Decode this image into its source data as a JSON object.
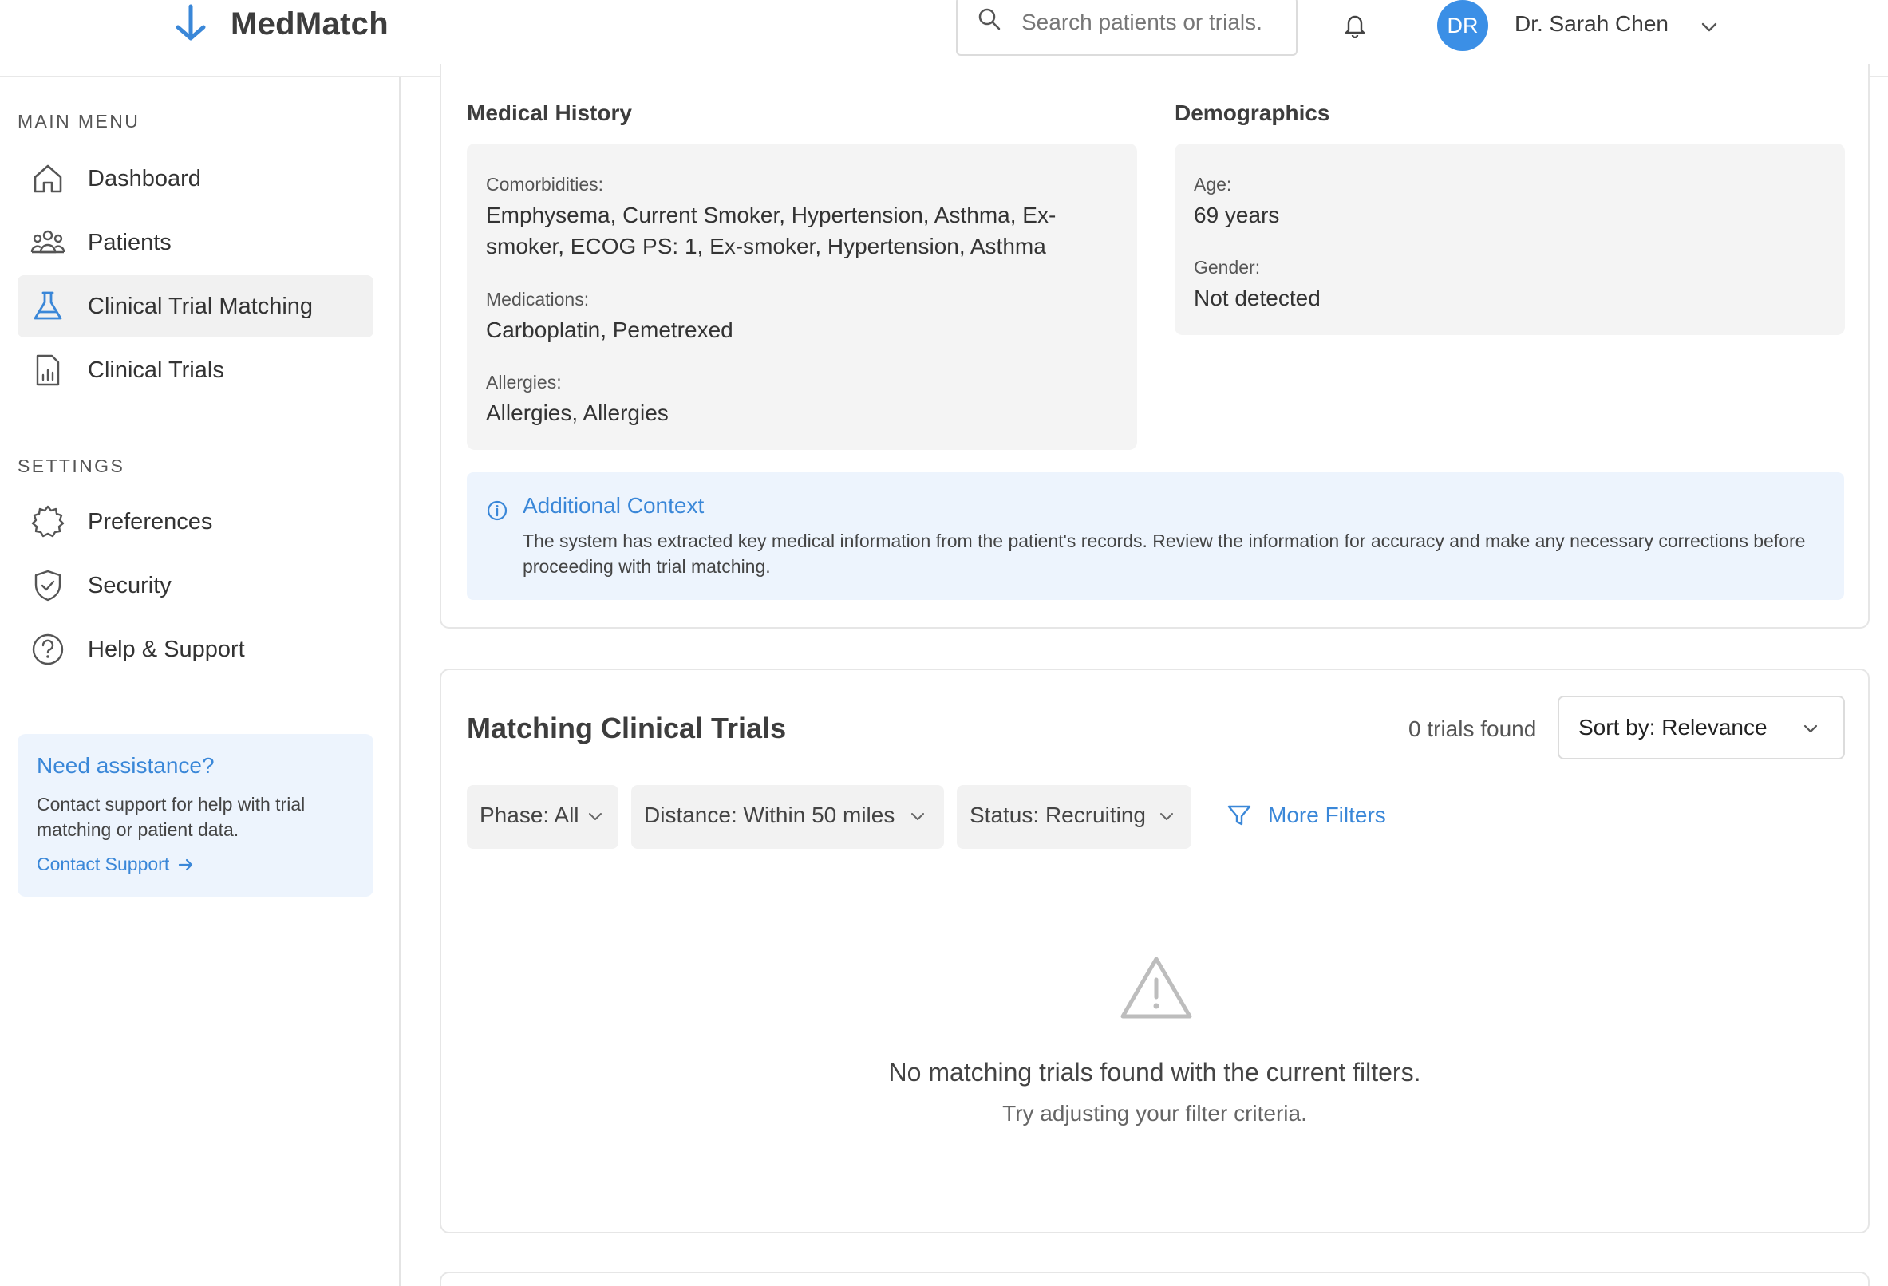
{
  "app": {
    "name": "MedMatch"
  },
  "header": {
    "search_placeholder": "Search patients or trials.",
    "user": {
      "initials": "DR",
      "name": "Dr. Sarah Chen"
    }
  },
  "sidebar": {
    "main_menu_label": "MAIN MENU",
    "main_items": [
      {
        "label": "Dashboard",
        "icon": "home-icon"
      },
      {
        "label": "Patients",
        "icon": "users-icon"
      },
      {
        "label": "Clinical Trial Matching",
        "icon": "flask-icon",
        "active": true
      },
      {
        "label": "Clinical Trials",
        "icon": "report-icon"
      }
    ],
    "settings_label": "SETTINGS",
    "settings_items": [
      {
        "label": "Preferences",
        "icon": "gear-icon"
      },
      {
        "label": "Security",
        "icon": "shield-icon"
      },
      {
        "label": "Help & Support",
        "icon": "help-icon"
      }
    ],
    "help_card": {
      "title": "Need assistance?",
      "text": "Contact support for help with trial matching or patient data.",
      "link": "Contact Support"
    }
  },
  "patient": {
    "medical_history_title": "Medical History",
    "comorbidities_label": "Comorbidities:",
    "comorbidities": "Emphysema, Current Smoker, Hypertension, Asthma, Ex-smoker, ECOG PS: 1, Ex-smoker, Hypertension, Asthma",
    "medications_label": "Medications:",
    "medications": "Carboplatin, Pemetrexed",
    "allergies_label": "Allergies:",
    "allergies": "Allergies, Allergies",
    "demographics_title": "Demographics",
    "age_label": "Age:",
    "age": "69 years",
    "gender_label": "Gender:",
    "gender": "Not detected"
  },
  "context": {
    "title": "Additional Context",
    "text": "The system has extracted key medical information from the patient's records. Review the information for accuracy and make any necessary corrections before proceeding with trial matching."
  },
  "trials": {
    "title": "Matching Clinical Trials",
    "count": "0 trials found",
    "sort": "Sort by: Relevance",
    "filters": {
      "phase": "Phase: All",
      "distance": "Distance: Within 50 miles",
      "status": "Status: Recruiting",
      "more": "More Filters"
    },
    "empty_title": "No matching trials found with the current filters.",
    "empty_subtitle": "Try adjusting your filter criteria."
  },
  "colors": {
    "accent": "#3a87d8",
    "avatar": "#3b8fe6",
    "context_bg": "#edf4fd"
  }
}
